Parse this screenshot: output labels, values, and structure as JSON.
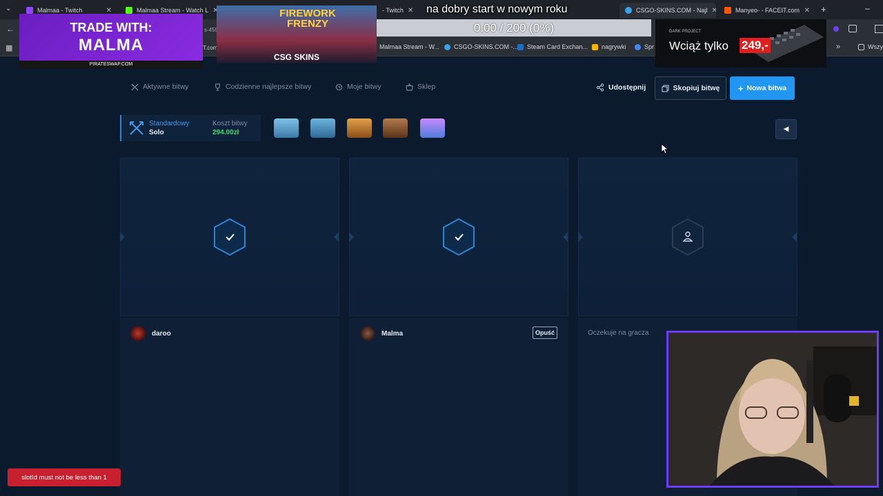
{
  "browser": {
    "tabs": [
      {
        "label": "Malmaa - Twitch",
        "color": "#9146ff"
      },
      {
        "label": "Malmaa Stream - Watch L",
        "color": "#53fc18"
      },
      {
        "label": "- Twitch",
        "color": "#9146ff"
      },
      {
        "label": "CSGO-SKINS.COM - Najl",
        "color": "#3aa3e8"
      },
      {
        "label": "Manyeo- - FACEIT.com",
        "color": "#ff5500"
      }
    ],
    "new_tab": "+",
    "minimize": "–",
    "url_fragment": "s-459",
    "url_fragment2": "T.com",
    "bookmarks": [
      {
        "label": "Malmaa Stream - W...",
        "color": "#53fc18"
      },
      {
        "label": "CSGO-SKINS.COM -...",
        "color": "#3aa3e8"
      },
      {
        "label": "Steam Card Exchan...",
        "color": "#1b6ec2"
      },
      {
        "label": "nagrywki",
        "color": "#f4b400"
      },
      {
        "label": "Spr",
        "color": "#4285f4"
      }
    ],
    "bookmarks_more": "»",
    "bookmarks_folder": "Wszy"
  },
  "nav": {
    "items": [
      {
        "label": "Aktywne bitwy",
        "icon": "swords-icon"
      },
      {
        "label": "Codzienne najlepsze bitwy",
        "icon": "trophy-icon"
      },
      {
        "label": "Moje bitwy",
        "icon": "history-icon"
      },
      {
        "label": "Sklep",
        "icon": "basket-icon"
      }
    ],
    "share": "Udostępnij",
    "copy": "Skopiuj bitwę",
    "new_battle": "Nowa bitwa"
  },
  "battle": {
    "mode": "Standardowy",
    "type": "Solo",
    "cost_label": "Koszt bitwy",
    "cost_value": "294.00zł",
    "cases": [
      {
        "color": "#5aa9d6"
      },
      {
        "color": "#4a94c4"
      },
      {
        "color": "#c97a2a"
      },
      {
        "color": "#8a5a34"
      },
      {
        "color": "#8b5cf6"
      }
    ]
  },
  "slots": [
    {
      "state": "ready",
      "player": "daroo",
      "avatar_color": "#6b1d1d"
    },
    {
      "state": "ready",
      "player": "Malma",
      "avatar_color": "#5a3a30",
      "action": "Opuść"
    },
    {
      "state": "waiting",
      "status": "Oczekuje na gracza"
    }
  ],
  "overlay": {
    "trade_title": "TRADE WITH:",
    "trade_name": "MALMA",
    "trade_site": "PIRATESWAP.COM",
    "game_title": "FIREWORK FRENZY",
    "game_brand": "CSG SKINS",
    "goal": "0.00 / 200 (0%)",
    "marquee": "na dobry start w nowym roku",
    "promo_brand": "DARK PROJECT",
    "promo_text": "Wciąż tylko",
    "promo_price": "249,-"
  },
  "toast": "slotId must not be less than 1"
}
